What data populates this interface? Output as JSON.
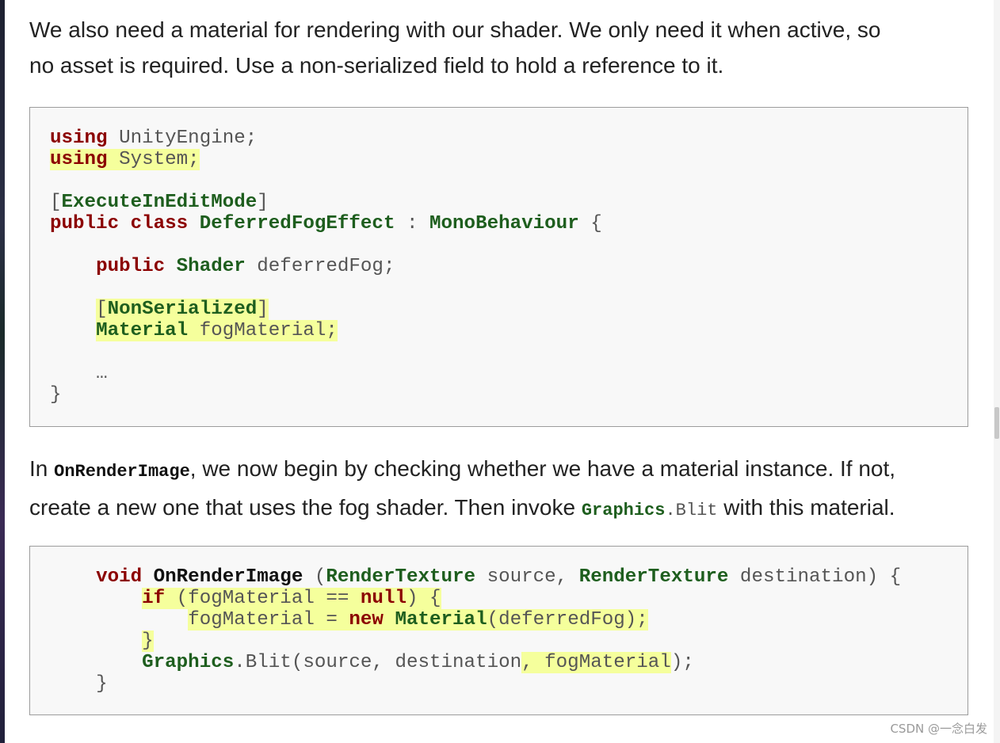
{
  "paragraph1": {
    "line1": "We also need a material for rendering with our shader. We only need it when active, so",
    "line2": "no asset is required. Use a non-serialized field to hold a reference to it."
  },
  "code1": {
    "using": "using",
    "unity_engine": " UnityEngine;",
    "system": " System;",
    "bracket_open": "[",
    "execute_in_edit_mode": "ExecuteInEditMode",
    "bracket_close": "]",
    "public": "public",
    "class": "class",
    "class_name": "DeferredFogEffect",
    "colon": " : ",
    "mono_behaviour": "MonoBehaviour",
    "brace_open": " {",
    "shader_type": "Shader",
    "deferred_fog": " deferredFog;",
    "non_serialized": "NonSerialized",
    "material_type": "Material",
    "fog_material": " fogMaterial;",
    "ellipsis": "…",
    "brace_close": "}"
  },
  "paragraph2": {
    "prefix": "In ",
    "method_name": "OnRenderImage",
    "middle1": ", we now begin by checking whether we have a material instance. If not,",
    "line2_prefix": "create a new one that uses the fog shader. Then invoke ",
    "graphics": "Graphics",
    "blit": ".Blit",
    "line2_suffix": " with this material."
  },
  "code2": {
    "void": "void",
    "on_render_image": "OnRenderImage",
    "open_paren": " (",
    "render_texture": "RenderTexture",
    "source": " source, ",
    "destination": " destination) {",
    "if": "if",
    "condition": " (fogMaterial == ",
    "null": "null",
    "cond_close": ") {",
    "assign": "fogMaterial = ",
    "new": "new",
    "material": "Material",
    "ctor_args": "(deferredFog);",
    "inner_close": "}",
    "graphics": "Graphics",
    "blit_call": ".Blit(source, destination",
    "blit_arg": ", fogMaterial",
    "blit_end": ");",
    "outer_close": "}"
  },
  "watermark": "CSDN @一念白发"
}
